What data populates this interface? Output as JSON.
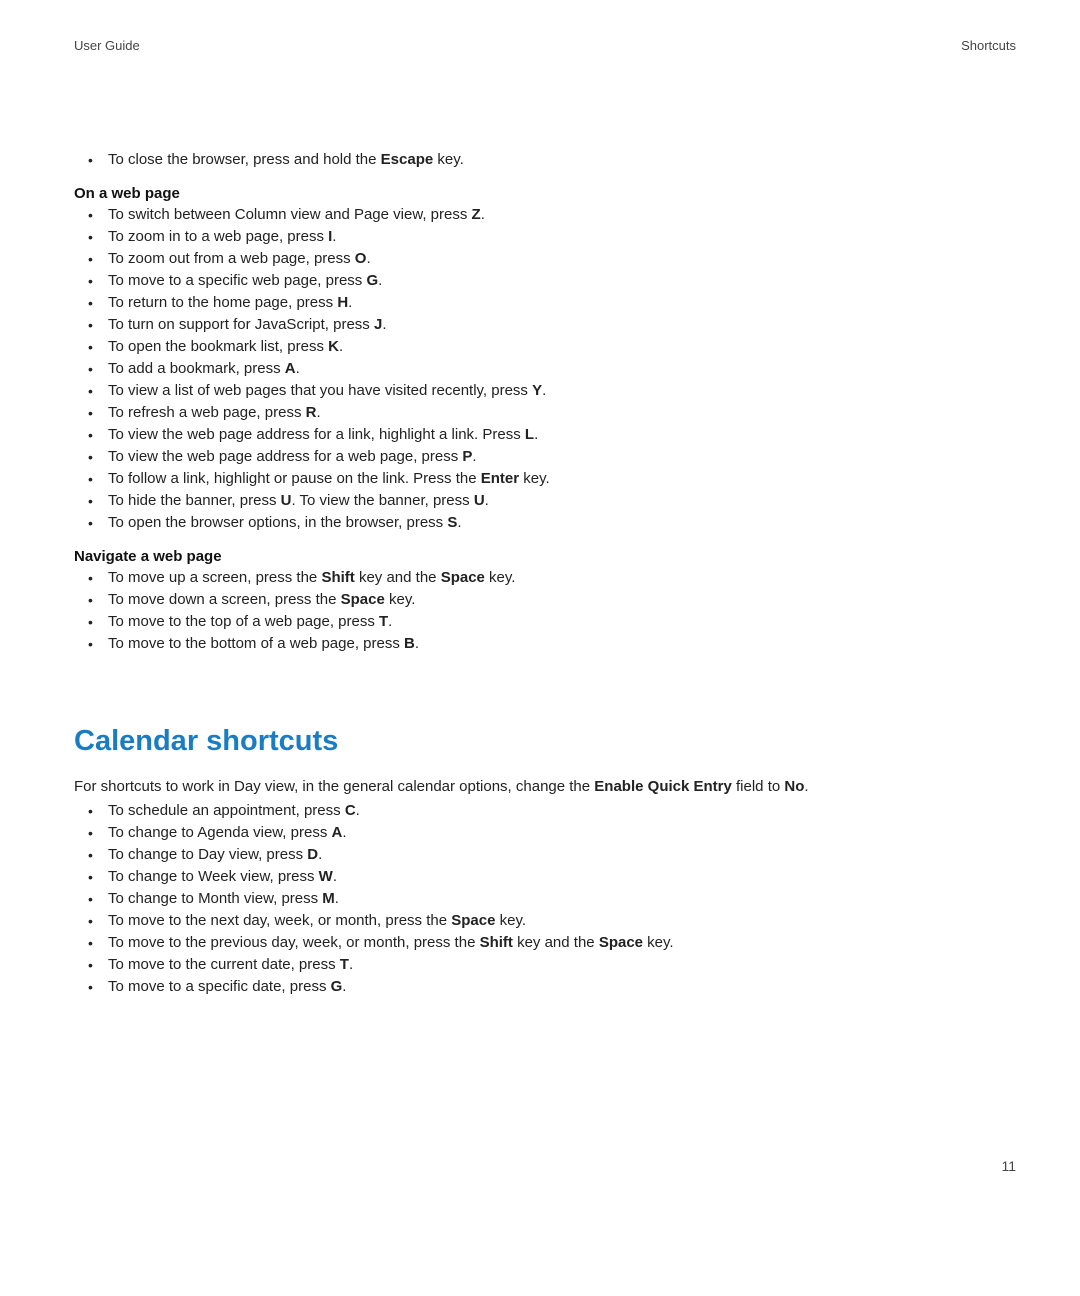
{
  "header": {
    "left": "User Guide",
    "right": "Shortcuts"
  },
  "intro_item": {
    "pre": "To close the browser, press and hold the ",
    "k1": "Escape",
    "post": " key."
  },
  "sub1": "On a web page",
  "web_items": [
    {
      "pre": "To switch between Column view and Page view, press ",
      "k1": "Z",
      "post": "."
    },
    {
      "pre": "To zoom in to a web page, press ",
      "k1": "I",
      "post": "."
    },
    {
      "pre": "To zoom out from a web page, press ",
      "k1": "O",
      "post": "."
    },
    {
      "pre": "To move to a specific web page, press ",
      "k1": "G",
      "post": "."
    },
    {
      "pre": "To return to the home page, press ",
      "k1": "H",
      "post": "."
    },
    {
      "pre": "To turn on support for JavaScript, press ",
      "k1": "J",
      "post": "."
    },
    {
      "pre": "To open the bookmark list, press ",
      "k1": "K",
      "post": "."
    },
    {
      "pre": "To add a bookmark, press ",
      "k1": "A",
      "post": "."
    },
    {
      "pre": "To view a list of web pages that you have visited recently, press ",
      "k1": "Y",
      "post": "."
    },
    {
      "pre": "To refresh a web page, press ",
      "k1": "R",
      "post": "."
    },
    {
      "pre": "To view the web page address for a link, highlight a link. Press ",
      "k1": "L",
      "post": "."
    },
    {
      "pre": "To view the web page address for a web page, press ",
      "k1": "P",
      "post": "."
    },
    {
      "pre": "To follow a link, highlight or pause on the link. Press the ",
      "k1": "Enter",
      "post": " key."
    },
    {
      "pre": "To hide the banner, press ",
      "k1": "U",
      "mid": ". To view the banner, press ",
      "k2": "U",
      "post": "."
    },
    {
      "pre": "To open the browser options, in the browser, press ",
      "k1": "S",
      "post": "."
    }
  ],
  "sub2": "Navigate a web page",
  "nav_items": [
    {
      "pre": "To move up a screen, press the ",
      "k1": "Shift",
      "mid": " key and the ",
      "k2": "Space",
      "post": " key."
    },
    {
      "pre": "To move down a screen, press the ",
      "k1": "Space",
      "post": " key."
    },
    {
      "pre": "To move to the top of a web page, press ",
      "k1": "T",
      "post": "."
    },
    {
      "pre": "To move to the bottom of a web page, press ",
      "k1": "B",
      "post": "."
    }
  ],
  "section_title": "Calendar shortcuts",
  "cal_intro": {
    "pre": "For shortcuts to work in Day view, in the general calendar options, change the ",
    "k1": "Enable Quick Entry",
    "mid": " field to ",
    "k2": "No",
    "post": "."
  },
  "cal_items": [
    {
      "pre": "To schedule an appointment, press ",
      "k1": "C",
      "post": "."
    },
    {
      "pre": "To change to Agenda view, press ",
      "k1": "A",
      "post": "."
    },
    {
      "pre": "To change to Day view, press ",
      "k1": "D",
      "post": "."
    },
    {
      "pre": "To change to Week view, press ",
      "k1": "W",
      "post": "."
    },
    {
      "pre": "To change to Month view, press ",
      "k1": "M",
      "post": "."
    },
    {
      "pre": "To move to the next day, week, or month, press the ",
      "k1": "Space",
      "post": " key."
    },
    {
      "pre": "To move to the previous day, week, or month, press the ",
      "k1": "Shift",
      "mid": " key and the ",
      "k2": "Space",
      "post": " key."
    },
    {
      "pre": "To move to the current date, press ",
      "k1": "T",
      "post": "."
    },
    {
      "pre": "To move to a specific date, press ",
      "k1": "G",
      "post": "."
    }
  ],
  "page_number": "11"
}
